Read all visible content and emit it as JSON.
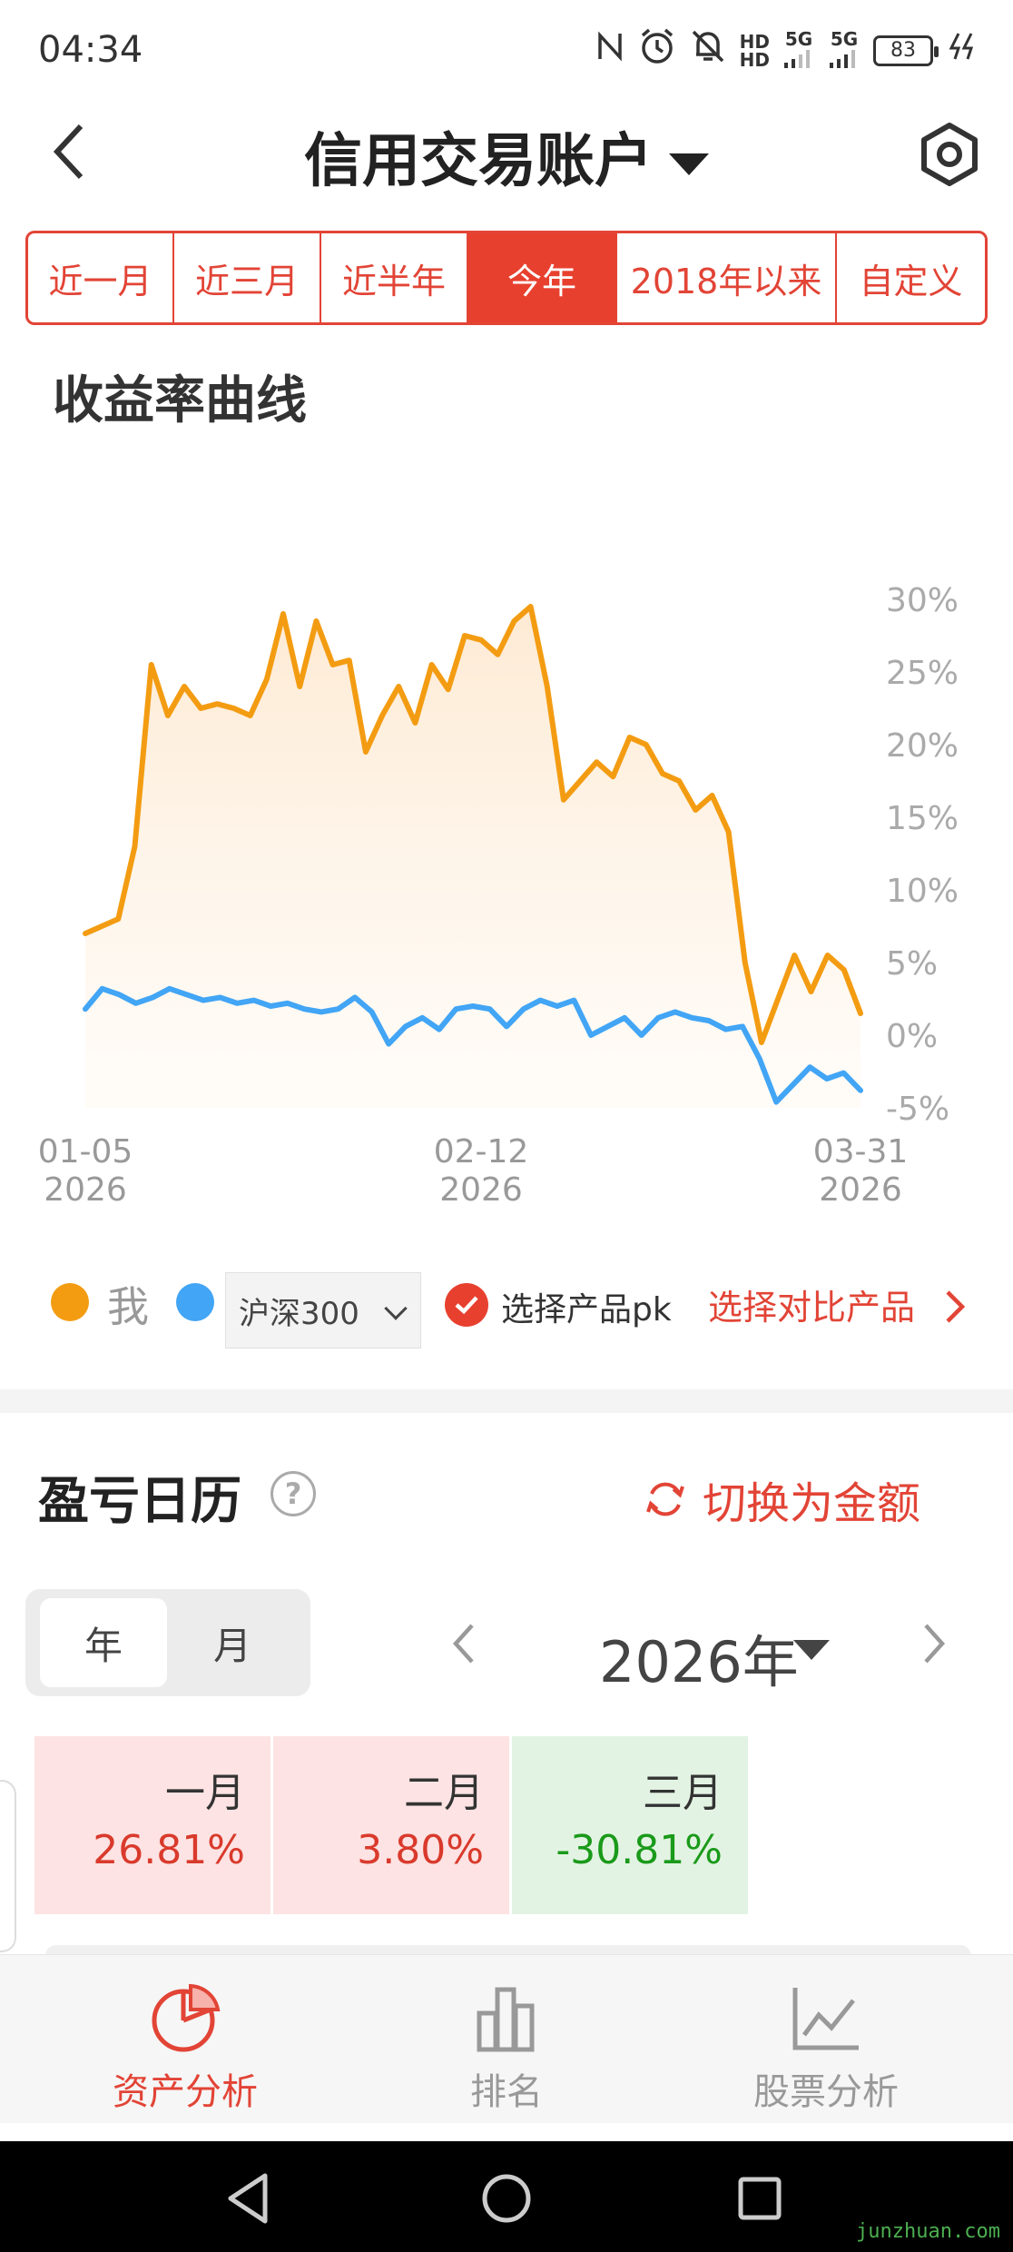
{
  "status_bar": {
    "time": "04:34",
    "hd_top": "HD",
    "hd_bottom": "HD",
    "signal1": "5G",
    "signal2": "5G",
    "battery": "83"
  },
  "header": {
    "title": "信用交易账户",
    "back_icon": "chevron-left-icon",
    "settings_icon": "gear-hexagon-icon"
  },
  "period_tabs": [
    {
      "label": "近一月",
      "active": false
    },
    {
      "label": "近三月",
      "active": false
    },
    {
      "label": "近半年",
      "active": false
    },
    {
      "label": "今年",
      "active": true
    },
    {
      "label": "2018年以来",
      "active": false
    },
    {
      "label": "自定义",
      "active": false
    }
  ],
  "section_title": "收益率曲线",
  "chart_data": {
    "type": "line",
    "x_labels": [
      {
        "date": "01-05",
        "year": "2026"
      },
      {
        "date": "02-12",
        "year": "2026"
      },
      {
        "date": "03-31",
        "year": "2026"
      }
    ],
    "ylim": [
      -5,
      30
    ],
    "yticks": [
      "30%",
      "25%",
      "20%",
      "15%",
      "10%",
      "5%",
      "0%",
      "-5%"
    ],
    "ytick_values": [
      30,
      25,
      20,
      15,
      10,
      5,
      0,
      -5
    ],
    "series": [
      {
        "name": "我",
        "color": "#f39c12",
        "fill": true,
        "values": [
          7,
          7.5,
          8,
          13,
          25.5,
          22,
          24,
          22.5,
          22.8,
          22.5,
          22,
          24.5,
          29,
          24,
          28.5,
          25.5,
          25.8,
          19.5,
          22,
          24,
          21.5,
          25.5,
          23.8,
          27.5,
          27.2,
          26.2,
          28.5,
          29.5,
          24,
          16.2,
          17.5,
          18.8,
          17.8,
          20.5,
          20,
          18,
          17.5,
          15.5,
          16.5,
          14,
          5,
          -0.5,
          2.5,
          5.5,
          3,
          5.5,
          4.5,
          1.5
        ]
      },
      {
        "name": "沪深300",
        "color": "#42a5f5",
        "fill": false,
        "values": [
          1.8,
          3.2,
          2.8,
          2.2,
          2.6,
          3.2,
          2.8,
          2.4,
          2.6,
          2.2,
          2.4,
          2.0,
          2.2,
          1.8,
          1.6,
          1.8,
          2.6,
          1.6,
          -0.6,
          0.6,
          1.2,
          0.4,
          1.8,
          2.0,
          1.8,
          0.6,
          1.8,
          2.4,
          2.0,
          2.4,
          0.0,
          0.6,
          1.2,
          0.0,
          1.2,
          1.6,
          1.2,
          1.0,
          0.4,
          0.6,
          -1.6,
          -4.6,
          -3.4,
          -2.2,
          -3.0,
          -2.6,
          -3.8
        ]
      }
    ]
  },
  "legend": {
    "me_label": "我",
    "me_color": "#f39c12",
    "bench_color": "#42a5f5",
    "bench_select": "沪深300",
    "pk_label": "选择产品pk",
    "compare_link": "选择对比产品"
  },
  "pnl": {
    "title": "盈亏日历",
    "switch_label": "切换为金额",
    "seg_year": "年",
    "seg_month": "月",
    "year": "2026年",
    "months": [
      {
        "name": "一月",
        "value": "26.81%",
        "sign": "pos"
      },
      {
        "name": "二月",
        "value": "3.80%",
        "sign": "pos"
      },
      {
        "name": "三月",
        "value": "-30.81%",
        "sign": "neg"
      }
    ]
  },
  "bottom_nav": [
    {
      "label": "资产分析",
      "icon": "pie-chart-icon",
      "active": true
    },
    {
      "label": "排名",
      "icon": "bar-chart-icon",
      "active": false
    },
    {
      "label": "股票分析",
      "icon": "line-chart-icon",
      "active": false
    }
  ],
  "watermark": "junzhuan.com"
}
